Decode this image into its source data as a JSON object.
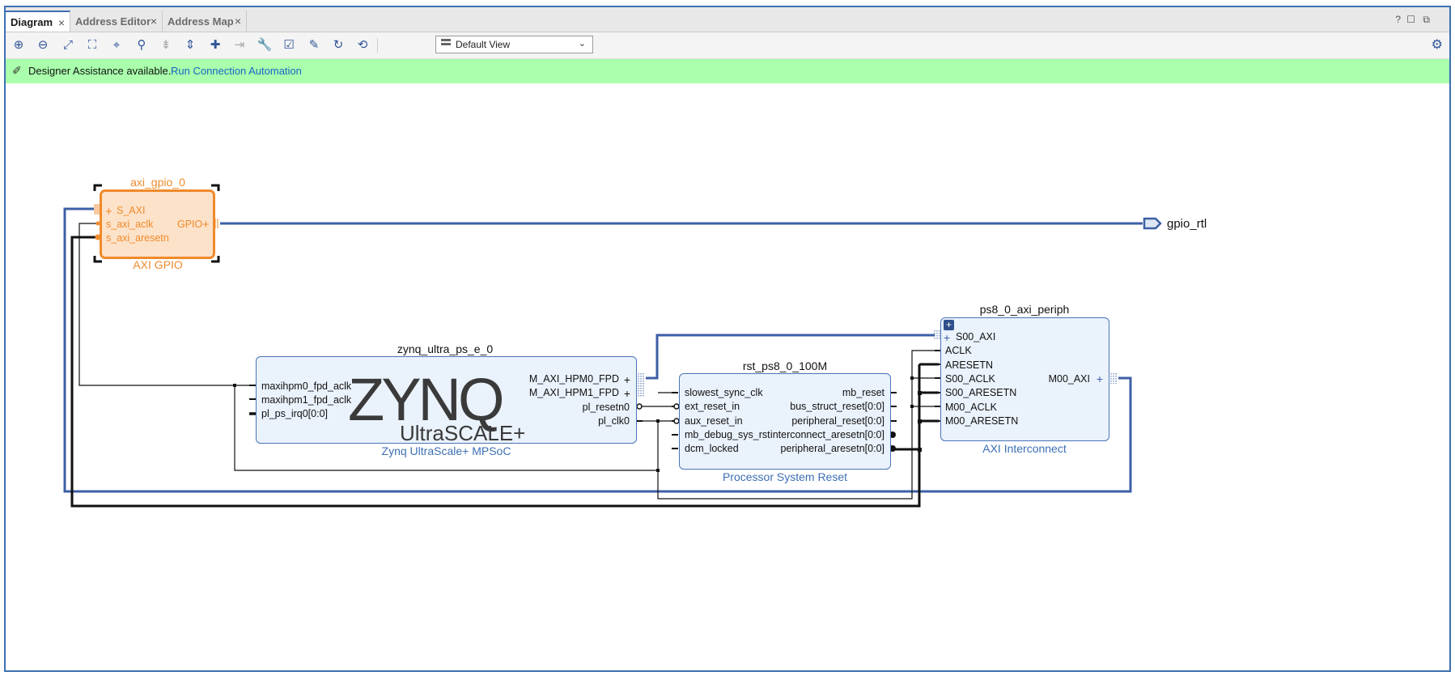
{
  "tabs": [
    {
      "label": "Diagram",
      "close": "×"
    },
    {
      "label": "Address Editor",
      "close": "×"
    },
    {
      "label": "Address Map",
      "close": "×"
    }
  ],
  "window_controls": {
    "help": "?",
    "restore": "☐",
    "float": "⧉"
  },
  "toolbar": {
    "view_select": "Default View"
  },
  "assist": {
    "message": "Designer Assistance available.",
    "link": "Run Connection Automation"
  },
  "diagram": {
    "gpio": {
      "instance": "axi_gpio_0",
      "type": "AXI GPIO",
      "ports_in": [
        "S_AXI",
        "s_axi_aclk",
        "s_axi_aresetn"
      ],
      "ports_out": [
        "GPIO"
      ]
    },
    "external_port": "gpio_rtl",
    "zynq": {
      "instance": "zynq_ultra_ps_e_0",
      "type": "Zynq UltraScale+ MPSoC",
      "logo_main": "ZYNQ",
      "logo_sub": "UltraSCALE+",
      "ports_in": [
        "maxihpm0_fpd_aclk",
        "maxihpm1_fpd_aclk",
        "pl_ps_irq0[0:0]"
      ],
      "ports_out": [
        "M_AXI_HPM0_FPD",
        "M_AXI_HPM1_FPD",
        "pl_resetn0",
        "pl_clk0"
      ]
    },
    "reset": {
      "instance": "rst_ps8_0_100M",
      "type": "Processor System Reset",
      "ports_in": [
        "slowest_sync_clk",
        "ext_reset_in",
        "aux_reset_in",
        "mb_debug_sys_rst",
        "dcm_locked"
      ],
      "ports_out": [
        "mb_reset",
        "bus_struct_reset[0:0]",
        "peripheral_reset[0:0]",
        "interconnect_aresetn[0:0]",
        "peripheral_aresetn[0:0]"
      ]
    },
    "interconnect": {
      "instance": "ps8_0_axi_periph",
      "type": "AXI Interconnect",
      "ports_in": [
        "S00_AXI",
        "ACLK",
        "ARESETN",
        "S00_ACLK",
        "S00_ARESETN",
        "M00_ACLK",
        "M00_ARESETN"
      ],
      "ports_out": [
        "M00_AXI"
      ]
    }
  }
}
